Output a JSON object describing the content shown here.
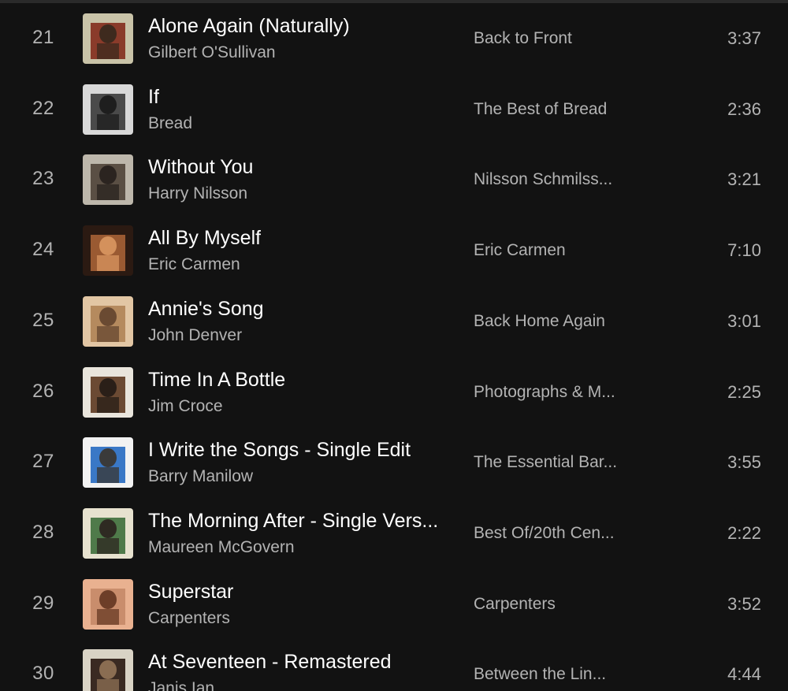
{
  "tracks": [
    {
      "number": "21",
      "title": "Alone Again (Naturally)",
      "artist": "Gilbert O'Sullivan",
      "album": "Back to Front",
      "duration": "3:37",
      "cover_colors": [
        "#c9c3a8",
        "#8a3b2a",
        "#3e2a1e"
      ]
    },
    {
      "number": "22",
      "title": "If",
      "artist": "Bread",
      "album": "The Best of Bread",
      "duration": "2:36",
      "cover_colors": [
        "#d8d8d8",
        "#4a4a4a",
        "#1e1e1e"
      ]
    },
    {
      "number": "23",
      "title": "Without You",
      "artist": "Harry Nilsson",
      "album": "Nilsson Schmilss...",
      "duration": "3:21",
      "cover_colors": [
        "#bdb7ab",
        "#5a4f44",
        "#2b2420"
      ]
    },
    {
      "number": "24",
      "title": "All By Myself",
      "artist": "Eric Carmen",
      "album": "Eric Carmen",
      "duration": "7:10",
      "cover_colors": [
        "#2b1a12",
        "#9a5a32",
        "#d4915c"
      ]
    },
    {
      "number": "25",
      "title": "Annie's Song",
      "artist": "John Denver",
      "album": "Back Home Again",
      "duration": "3:01",
      "cover_colors": [
        "#e2c6a4",
        "#b58a5e",
        "#6a4a32"
      ]
    },
    {
      "number": "26",
      "title": "Time In A Bottle",
      "artist": "Jim Croce",
      "album": "Photographs & M...",
      "duration": "2:25",
      "cover_colors": [
        "#e9e5dc",
        "#6b4a33",
        "#2a1f18"
      ]
    },
    {
      "number": "27",
      "title": "I Write the Songs - Single Edit",
      "artist": "Barry Manilow",
      "album": "The Essential Bar...",
      "duration": "3:55",
      "cover_colors": [
        "#f2f2f2",
        "#3a78c6",
        "#3a3a3a"
      ]
    },
    {
      "number": "28",
      "title": "The Morning After - Single Vers...",
      "artist": "Maureen McGovern",
      "album": "Best Of/20th Cen...",
      "duration": "2:22",
      "cover_colors": [
        "#e7e2cf",
        "#4f7a4a",
        "#2e2a22"
      ]
    },
    {
      "number": "29",
      "title": "Superstar",
      "artist": "Carpenters",
      "album": "Carpenters",
      "duration": "3:52",
      "cover_colors": [
        "#e9b190",
        "#c98d6c",
        "#6d3e28"
      ]
    },
    {
      "number": "30",
      "title": "At Seventeen - Remastered",
      "artist": "Janis Ian",
      "album": "Between the Lin...",
      "duration": "4:44",
      "cover_colors": [
        "#d9d3c5",
        "#3a2a22",
        "#8a6d52"
      ]
    }
  ]
}
